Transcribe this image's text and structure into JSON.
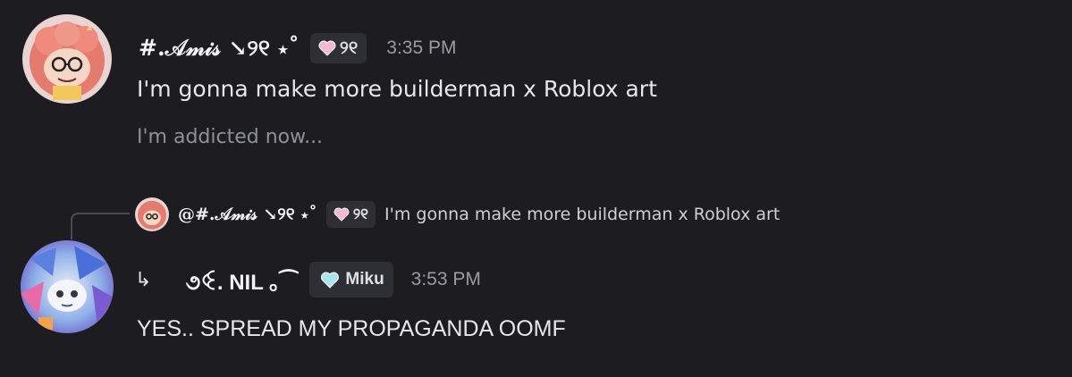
{
  "messages": [
    {
      "author": {
        "name": "#.𝒜𝓂𝒾𝓈 ↘୨୧ ⋆˚",
        "tag": "୨୧",
        "tag_color": "#f4b8d6"
      },
      "timestamp": "3:35 PM",
      "lines": [
        "I'm gonna make more builderman x Roblox art",
        "I'm addicted now..."
      ]
    },
    {
      "reply_to": {
        "mention": "@#.𝒜𝓂𝒾𝓈 ↘୨୧ ⋆˚",
        "tag": "୨୧",
        "tag_color": "#f4b8d6",
        "preview": "I'm gonna make more builderman x Roblox art"
      },
      "author": {
        "prefix": "↳",
        "name": "૭ꒊ. NIL ｡⁀",
        "tag": "Miku",
        "tag_color": "#a8e6ef"
      },
      "timestamp": "3:53 PM",
      "lines": [
        "YES.. SPREAD MY PROPAGANDA OOMF"
      ]
    }
  ]
}
